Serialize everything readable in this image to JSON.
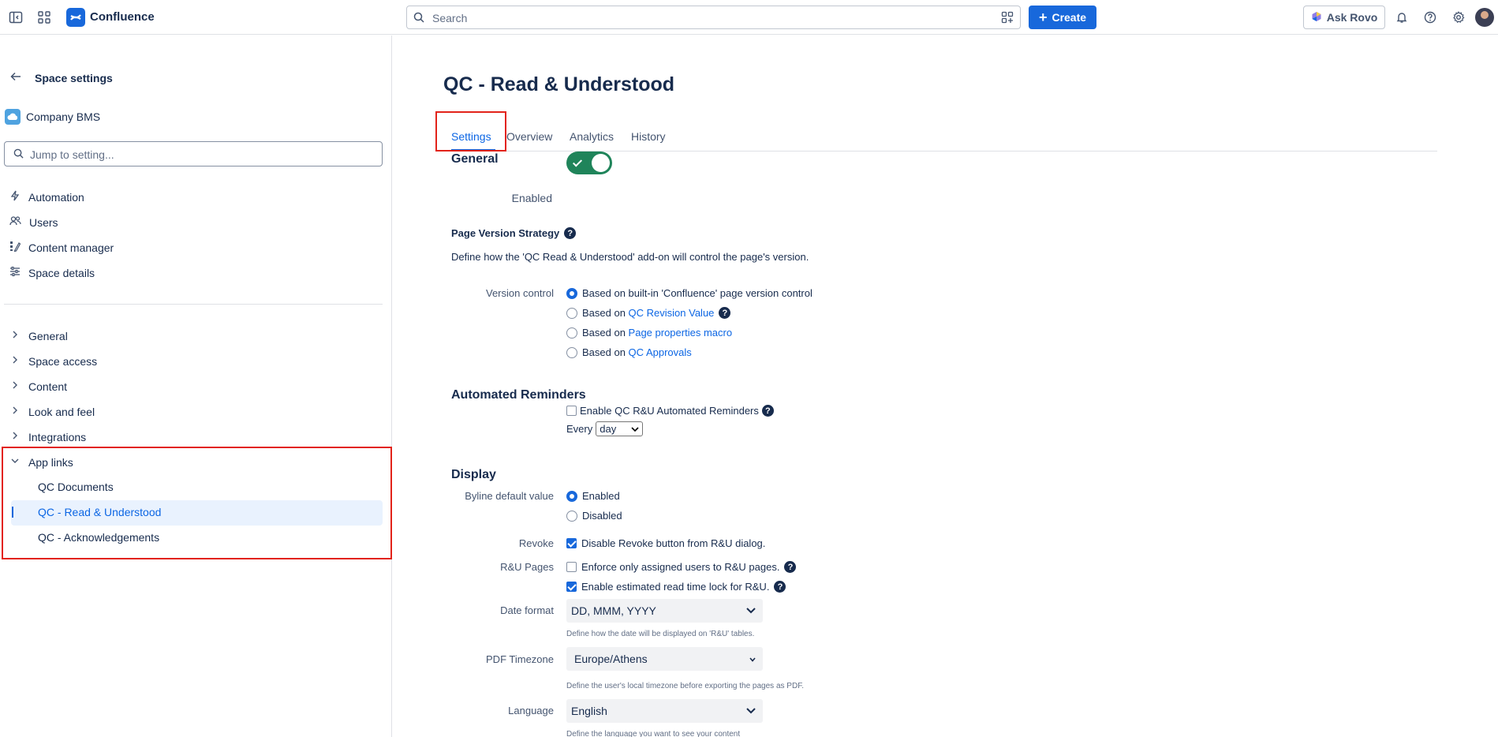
{
  "topbar": {
    "app_name": "Confluence",
    "search_placeholder": "Search",
    "create_label": "Create",
    "rovo_label": "Ask Rovo"
  },
  "sidebar": {
    "back_title": "Space settings",
    "space_name": "Company BMS",
    "jump_placeholder": "Jump to setting...",
    "primary_items": [
      {
        "label": "Automation",
        "icon": "lightning-icon"
      },
      {
        "label": "Users",
        "icon": "people-icon"
      },
      {
        "label": "Content manager",
        "icon": "content-manager-icon"
      },
      {
        "label": "Space details",
        "icon": "sliders-icon"
      }
    ],
    "sections": [
      "General",
      "Space access",
      "Content",
      "Look and feel",
      "Integrations"
    ],
    "app_links": {
      "label": "App links",
      "items": [
        "QC Documents",
        "QC - Read & Understood",
        "QC - Acknowledgements"
      ],
      "active": "QC - Read & Understood"
    }
  },
  "main": {
    "title": "QC - Read & Understood",
    "tabs": [
      "Settings",
      "Overview",
      "Analytics",
      "History"
    ],
    "active_tab": "Settings",
    "general": {
      "heading": "General",
      "enabled_label": "Enabled",
      "enabled": true
    },
    "version_strategy": {
      "heading": "Page Version Strategy",
      "description": "Define how the 'QC Read & Understood' add-on will control the page's version.",
      "label": "Version control",
      "options": [
        {
          "prefix": "Based on built-in 'Confluence' page version control",
          "link": "",
          "selected": true
        },
        {
          "prefix": "Based on ",
          "link": "QC Revision Value",
          "selected": false
        },
        {
          "prefix": "Based on ",
          "link": "Page properties macro",
          "selected": false
        },
        {
          "prefix": "Based on ",
          "link": "QC Approvals",
          "selected": false
        }
      ]
    },
    "reminders": {
      "heading": "Automated Reminders",
      "checkbox_label": "Enable QC R&U Automated Reminders",
      "checked": false,
      "every_label": "Every",
      "every_value": "day"
    },
    "display": {
      "heading": "Display",
      "byline_label": "Byline default value",
      "byline_options": [
        "Enabled",
        "Disabled"
      ],
      "byline_selected": "Enabled",
      "revoke_label": "Revoke",
      "revoke_checkbox": "Disable Revoke button from R&U dialog.",
      "revoke_checked": true,
      "ru_pages_label": "R&U Pages",
      "ru_enforce": "Enforce only assigned users to R&U pages.",
      "ru_enforce_checked": false,
      "ru_readtime": "Enable estimated read time lock for R&U.",
      "ru_readtime_checked": true,
      "date_format_label": "Date format",
      "date_format_value": "DD, MMM, YYYY",
      "date_format_hint": "Define how the date will be displayed on 'R&U' tables.",
      "pdf_tz_label": "PDF Timezone",
      "pdf_tz_value": "Europe/Athens",
      "pdf_tz_hint": "Define the user's local timezone before exporting the pages as PDF.",
      "language_label": "Language",
      "language_value": "English",
      "language_hint": "Define the language you want to see your content"
    }
  },
  "colors": {
    "accent": "#1868db",
    "toggle_on": "#1f845a",
    "highlight_box": "#e2231a",
    "active_nav_bg": "#e9f2fe"
  }
}
